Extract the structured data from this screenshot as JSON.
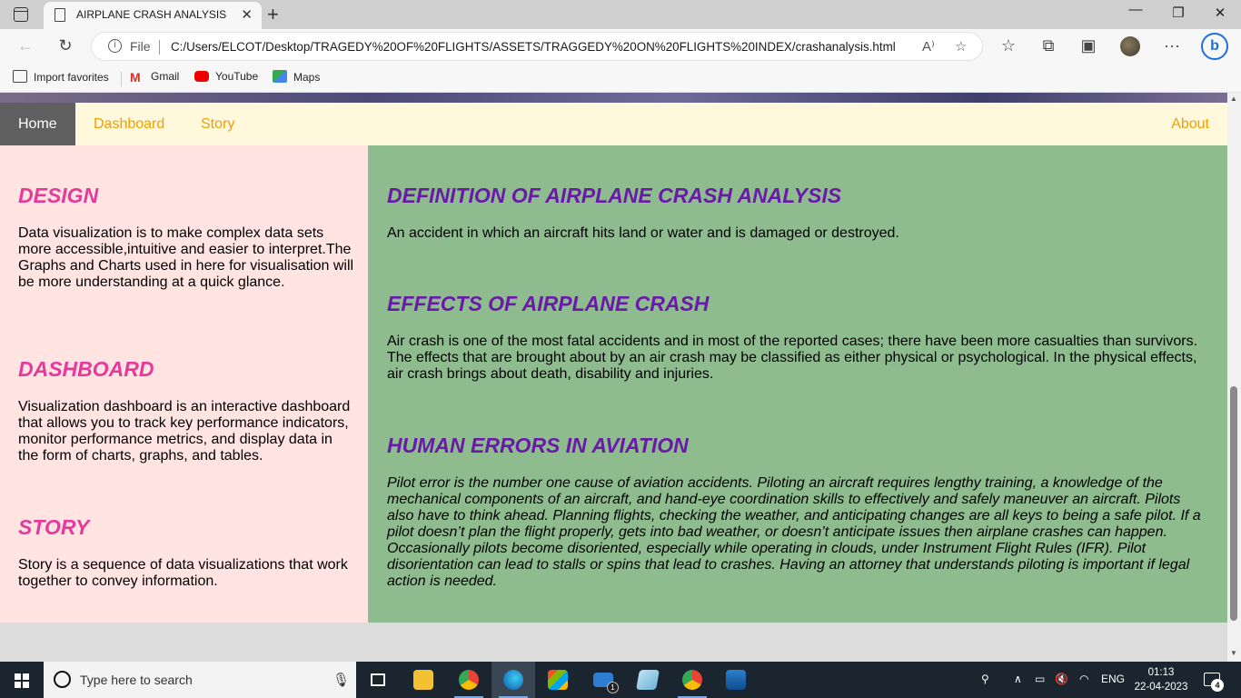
{
  "browser": {
    "tab_title": "AIRPLANE CRASH ANALYSIS",
    "close_tab": "✕",
    "new_tab": "+",
    "file_label": "File",
    "url": "C:/Users/ELCOT/Desktop/TRAGEDY%20OF%20FLIGHTS/ASSETS/TRAGGEDY%20ON%20FLIGHTS%20INDEX/crashanalysis.html",
    "favorites": [
      "Import favorites",
      "Gmail",
      "YouTube",
      "Maps"
    ]
  },
  "page": {
    "nav": {
      "home": "Home",
      "dashboard": "Dashboard",
      "story": "Story",
      "about": "About"
    },
    "left": {
      "design_heading": "DESIGN",
      "design_text": "Data visualization is to make complex data sets more accessible,intuitive and easier to interpret.The Graphs and Charts used in here for visualisation will be more understanding at a quick glance.",
      "dashboard_heading": "DASHBOARD",
      "dashboard_text": "Visualization dashboard is an interactive dashboard that allows you to track key performance indicators, monitor performance metrics, and display data in the form of charts, graphs, and tables.",
      "story_heading": "STORY",
      "story_text": "Story is a sequence of data visualizations that work together to convey information."
    },
    "right": {
      "definition_heading": "DEFINITION OF AIRPLANE CRASH ANALYSIS",
      "definition_text": "An accident in which an aircraft hits land or water and is damaged or destroyed.",
      "effects_heading": "EFFECTS OF AIRPLANE CRASH",
      "effects_text": "Air crash is one of the most fatal accidents and in most of the reported cases; there have been more casualties than survivors. The effects that are brought about by an air crash may be classified as either physical or psychological. In the physical effects, air crash brings about death, disability and injuries.",
      "human_heading": "HUMAN ERRORS IN AVIATION",
      "human_text": "Pilot error is the number one cause of aviation accidents. Piloting an aircraft requires lengthy training, a knowledge of the mechanical components of an aircraft, and hand-eye coordination skills to effectively and safely maneuver an aircraft. Pilots also have to think ahead. Planning flights, checking the weather, and anticipating changes are all keys to being a safe pilot. If a pilot doesn’t plan the flight properly, gets into bad weather, or doesn’t anticipate issues then airplane crashes can happen. Occasionally pilots become disoriented, especially while operating in clouds, under Instrument Flight Rules (IFR). Pilot disorientation can lead to stalls or spins that lead to crashes. Having an attorney that understands piloting is important if legal action is needed."
    }
  },
  "taskbar": {
    "search_placeholder": "Type here to search",
    "mail_badge": "1",
    "language": "ENG",
    "time": "01:13",
    "date": "22-04-2023",
    "notification_count": "4"
  },
  "colors": {
    "nav_bg": "#fff8dc",
    "nav_link": "#f0a000",
    "nav_active_bg": "#5f5f5f",
    "left_bg": "#ffe4e1",
    "right_bg": "#8fbc8f",
    "left_heading": "#e6399b",
    "right_heading": "#6a1aa8"
  }
}
